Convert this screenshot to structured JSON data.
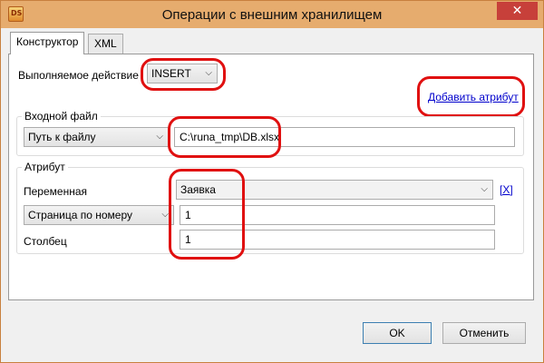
{
  "window": {
    "title": "Операции с внешним хранилищем",
    "close_symbol": "✕",
    "app_icon_text": "DS"
  },
  "tabs": [
    {
      "label": "Конструктор",
      "active": true
    },
    {
      "label": "XML",
      "active": false
    }
  ],
  "action": {
    "label": "Выполняемое действие",
    "value": "INSERT"
  },
  "add_attribute_link": "Добавить атрибут",
  "input_file": {
    "group_title": "Входной файл",
    "mode": "Путь к файлу",
    "path": "C:\\runa_tmp\\DB.xlsx"
  },
  "attribute": {
    "group_title": "Атрибут",
    "variable_label": "Переменная",
    "variable_value": "Заявка",
    "remove_label": "[X]",
    "page_mode": "Страница по номеру",
    "page_value": "1",
    "column_label": "Столбец",
    "column_value": "1"
  },
  "buttons": {
    "ok": "OK",
    "cancel": "Отменить"
  },
  "icons": {
    "chevron": "⌵"
  },
  "colors": {
    "titlebar": "#e6ac6e",
    "close": "#c7403a",
    "highlight": "#e01010",
    "link": "#0000cc"
  }
}
